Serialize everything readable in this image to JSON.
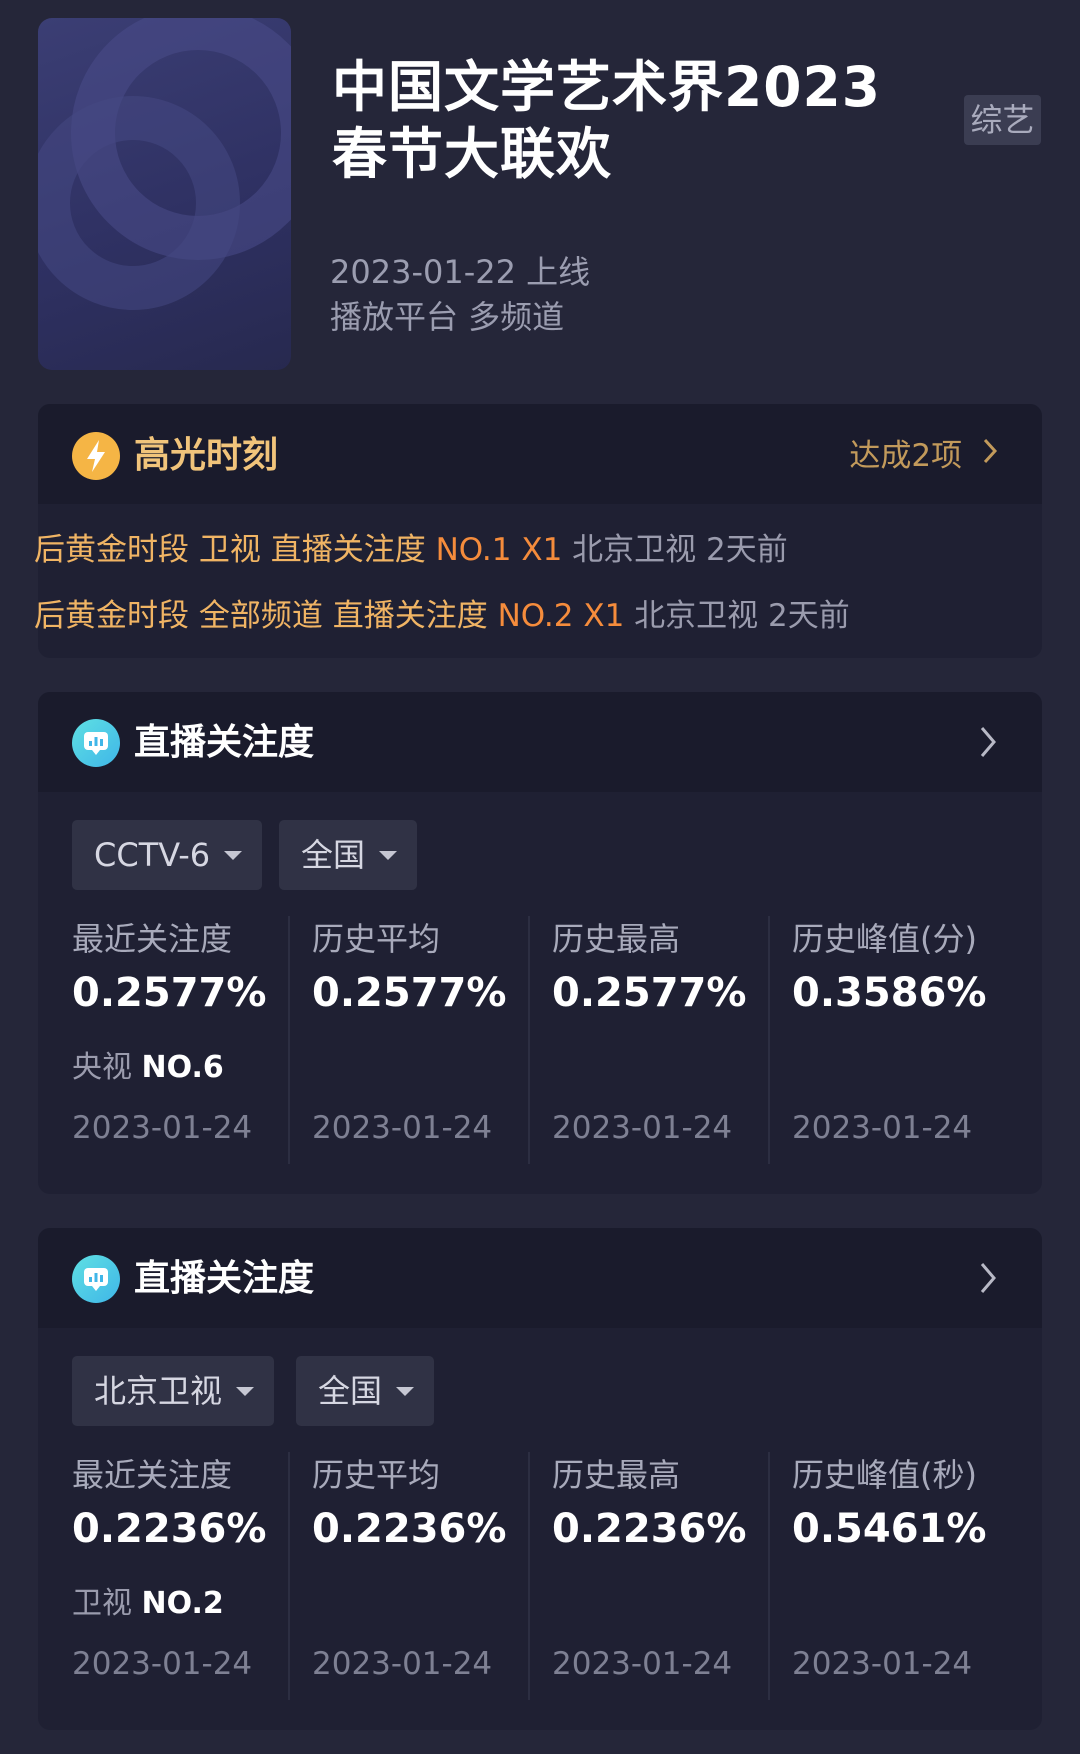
{
  "show": {
    "title": "中国文学艺术界2023春节大联欢",
    "category_tag": "综艺",
    "release": "2023-01-22 上线",
    "platform": "播放平台 多频道",
    "poster_icon": "poster-image"
  },
  "highlights": {
    "title": "高光时刻",
    "icon": "lightning-icon",
    "achieved": "达成2项",
    "rows": [
      {
        "slot": "后黄金时段 卫视 直播关注度",
        "rank": "NO.1 X1",
        "channel": "北京卫视",
        "time": "2天前"
      },
      {
        "slot": "后黄金时段 全部频道 直播关注度",
        "rank": "NO.2 X1",
        "channel": "北京卫视",
        "time": "2天前"
      }
    ]
  },
  "attention_cards": [
    {
      "title": "直播关注度",
      "channel": "CCTV-6",
      "region": "全国",
      "stats": [
        {
          "label": "最近关注度",
          "value": "0.2577%",
          "rank_prefix": "央视",
          "rank": "NO.6",
          "date": "2023-01-24"
        },
        {
          "label": "历史平均",
          "value": "0.2577%",
          "date": "2023-01-24"
        },
        {
          "label": "历史最高",
          "value": "0.2577%",
          "date": "2023-01-24"
        },
        {
          "label": "历史峰值(分)",
          "value": "0.3586%",
          "date": "2023-01-24"
        }
      ]
    },
    {
      "title": "直播关注度",
      "channel": "北京卫视",
      "region": "全国",
      "stats": [
        {
          "label": "最近关注度",
          "value": "0.2236%",
          "rank_prefix": "卫视",
          "rank": "NO.2",
          "date": "2023-01-24"
        },
        {
          "label": "历史平均",
          "value": "0.2236%",
          "date": "2023-01-24"
        },
        {
          "label": "历史最高",
          "value": "0.2236%",
          "date": "2023-01-24"
        },
        {
          "label": "历史峰值(秒)",
          "value": "0.5461%",
          "date": "2023-01-24"
        }
      ]
    }
  ],
  "colors": {
    "background": "#252639",
    "card": "#1f2033",
    "gold": "#f0b464",
    "orange": "#f58c3c",
    "cyan": "#4cc9e6"
  }
}
